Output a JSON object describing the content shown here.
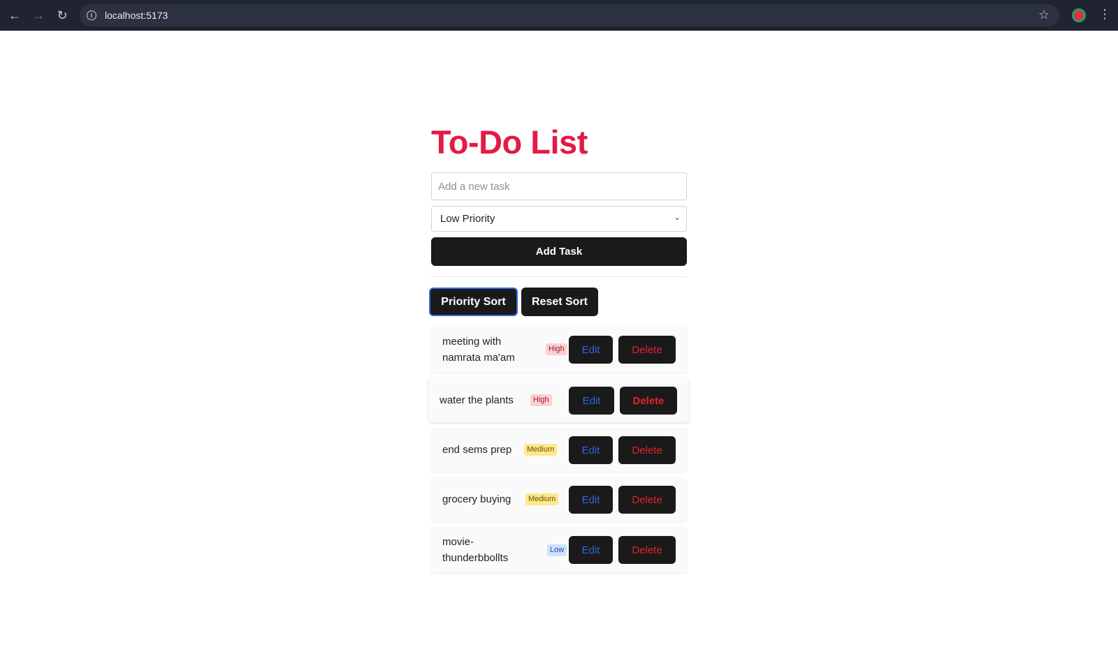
{
  "browser": {
    "url": "localhost:5173"
  },
  "app": {
    "title": "To-Do List",
    "input_placeholder": "Add a new task",
    "priority_selected": "Low Priority",
    "add_button": "Add Task",
    "priority_sort_button": "Priority Sort",
    "reset_sort_button": "Reset Sort",
    "edit_label": "Edit",
    "delete_label": "Delete"
  },
  "tasks": [
    {
      "line1": "meeting with",
      "line2": "namrata ma'am",
      "priority": "High"
    },
    {
      "line1": "water the plants",
      "line2": "",
      "priority": "High"
    },
    {
      "line1": "end sems prep",
      "line2": "",
      "priority": "Medium"
    },
    {
      "line1": "grocery buying",
      "line2": "",
      "priority": "Medium"
    },
    {
      "line1": "movie-",
      "line2": "thunderbbollts",
      "priority": "Low"
    }
  ]
}
